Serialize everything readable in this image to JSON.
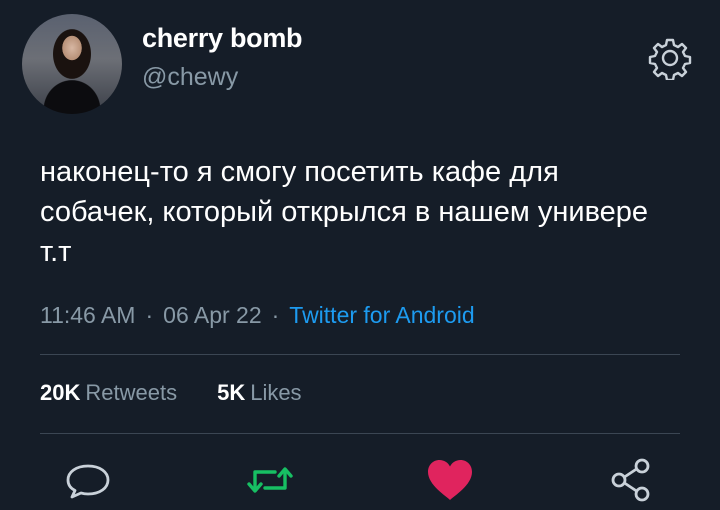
{
  "user": {
    "display_name": "cherry bomb",
    "handle": "@chewy"
  },
  "tweet": {
    "text": "наконец-то я смогу посетить кафе для собачек, который открылся в нашем универе т.т",
    "time": "11:46 AM",
    "separator": "·",
    "date": "06 Apr 22",
    "source": "Twitter for Android"
  },
  "stats": {
    "retweets_count": "20K",
    "retweets_label": "Retweets",
    "likes_count": "5K",
    "likes_label": "Likes"
  },
  "icons": {
    "settings": "gear-icon",
    "reply": "comment-icon",
    "retweet": "retweet-icon",
    "like": "heart-icon",
    "share": "share-icon"
  },
  "colors": {
    "background": "#151d28",
    "secondary_text": "#8899a6",
    "link": "#1d9bf0",
    "retweet": "#17bf63",
    "like": "#e0245e",
    "divider": "#3b4653"
  }
}
